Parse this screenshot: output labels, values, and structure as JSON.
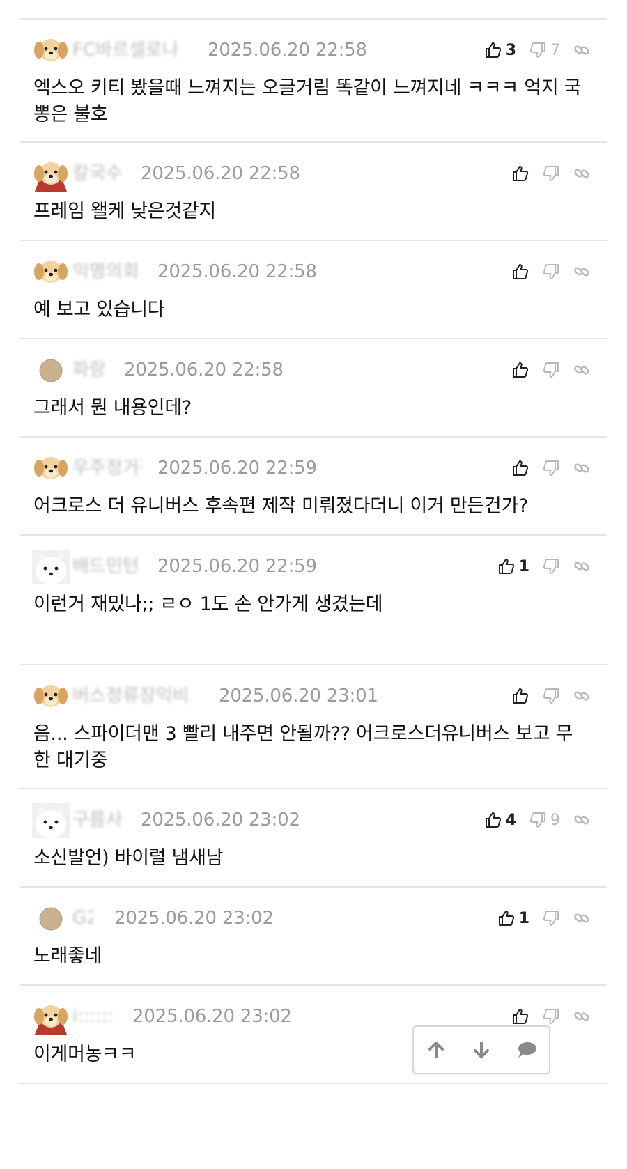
{
  "comments": [
    {
      "nick": "FC바르셀로나",
      "date": "2025.06.20 22:58",
      "avatar": "puppy",
      "likes": "3",
      "dislikes": "7",
      "text": "엑스오 키티 봤을때 느껴지는 오글거림 똑같이 느껴지네 ㅋㅋㅋ 억지 국뽕은 불호"
    },
    {
      "nick": "칼국수",
      "date": "2025.06.20 22:58",
      "avatar": "puppy-red",
      "likes": "",
      "dislikes": "",
      "text": "프레임 왤케 낮은것같지"
    },
    {
      "nick": "익명의회원",
      "date": "2025.06.20 22:58",
      "avatar": "puppy",
      "likes": "",
      "dislikes": "",
      "text": "예 보고 있습니다"
    },
    {
      "nick": "파랑",
      "date": "2025.06.20 22:58",
      "avatar": "circle",
      "likes": "",
      "dislikes": "",
      "text": "그래서 뭔 내용인데?"
    },
    {
      "nick": "우주정거장",
      "date": "2025.06.20 22:59",
      "avatar": "puppy",
      "likes": "",
      "dislikes": "",
      "text": "어크로스 더 유니버스 후속편 제작 미뤄졌다더니 이거 만든건가?"
    },
    {
      "nick": "배드민턴",
      "date": "2025.06.20 22:59",
      "avatar": "white-dog",
      "likes": "1",
      "dislikes": "",
      "text": "이런거 재밌나;; ㄹㅇ 1도 손 안가게 생겼는데"
    },
    {
      "nick": "버스정류장익비",
      "date": "2025.06.20 23:01",
      "avatar": "puppy",
      "likes": "",
      "dislikes": "",
      "text": "음... 스파이더맨 3 빨리 내주면 안될까?? 어크로스더유니버스 보고 무한 대기중"
    },
    {
      "nick": "구름사냥",
      "date": "2025.06.20 23:02",
      "avatar": "white-dog",
      "likes": "4",
      "dislikes": "9",
      "text": "소신발언) 바이럴 냄새남"
    },
    {
      "nick": "G2",
      "date": "2025.06.20 23:02",
      "avatar": "circle",
      "likes": "1",
      "dislikes": "",
      "text": "노래좋네"
    },
    {
      "nick": "i:::::::",
      "date": "2025.06.20 23:02",
      "avatar": "puppy-red",
      "likes": "",
      "dislikes": "",
      "text": "이게머농ㅋㅋ"
    }
  ],
  "nav": {
    "up_icon": "arrow-up-icon",
    "down_icon": "arrow-down-icon",
    "comment_icon": "speech-bubble-icon"
  },
  "colors": {
    "divider": "#e4e4e4",
    "date": "#9b9b9b",
    "icon": "#222222",
    "icon_muted": "#b8b8b8"
  }
}
